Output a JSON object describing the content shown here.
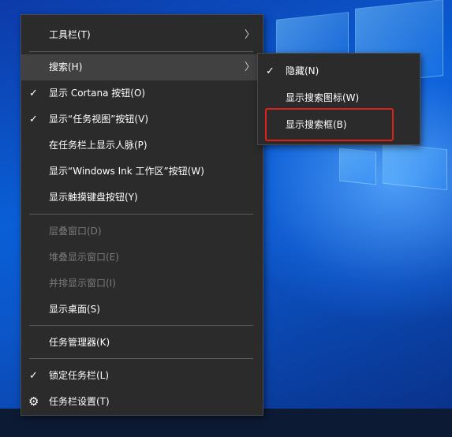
{
  "main_menu": {
    "items": [
      {
        "label": "工具栏(T)"
      },
      {
        "label": "搜索(H)"
      },
      {
        "label": "显示 Cortana 按钮(O)"
      },
      {
        "label": "显示“任务视图”按钮(V)"
      },
      {
        "label": "在任务栏上显示人脉(P)"
      },
      {
        "label": "显示“Windows Ink 工作区”按钮(W)"
      },
      {
        "label": "显示触摸键盘按钮(Y)"
      },
      {
        "label": "层叠窗口(D)"
      },
      {
        "label": "堆叠显示窗口(E)"
      },
      {
        "label": "并排显示窗口(I)"
      },
      {
        "label": "显示桌面(S)"
      },
      {
        "label": "任务管理器(K)"
      },
      {
        "label": "锁定任务栏(L)"
      },
      {
        "label": "任务栏设置(T)"
      }
    ]
  },
  "sub_menu": {
    "items": [
      {
        "label": "隐藏(N)"
      },
      {
        "label": "显示搜索图标(W)"
      },
      {
        "label": "显示搜索框(B)"
      }
    ]
  },
  "glyphs": {
    "check": "✓",
    "arrow": "〉",
    "gear": "⚙"
  },
  "colors": {
    "menu_bg": "#2b2b2b",
    "highlight_bg": "#414141",
    "annotation_box": "#e0201b"
  }
}
